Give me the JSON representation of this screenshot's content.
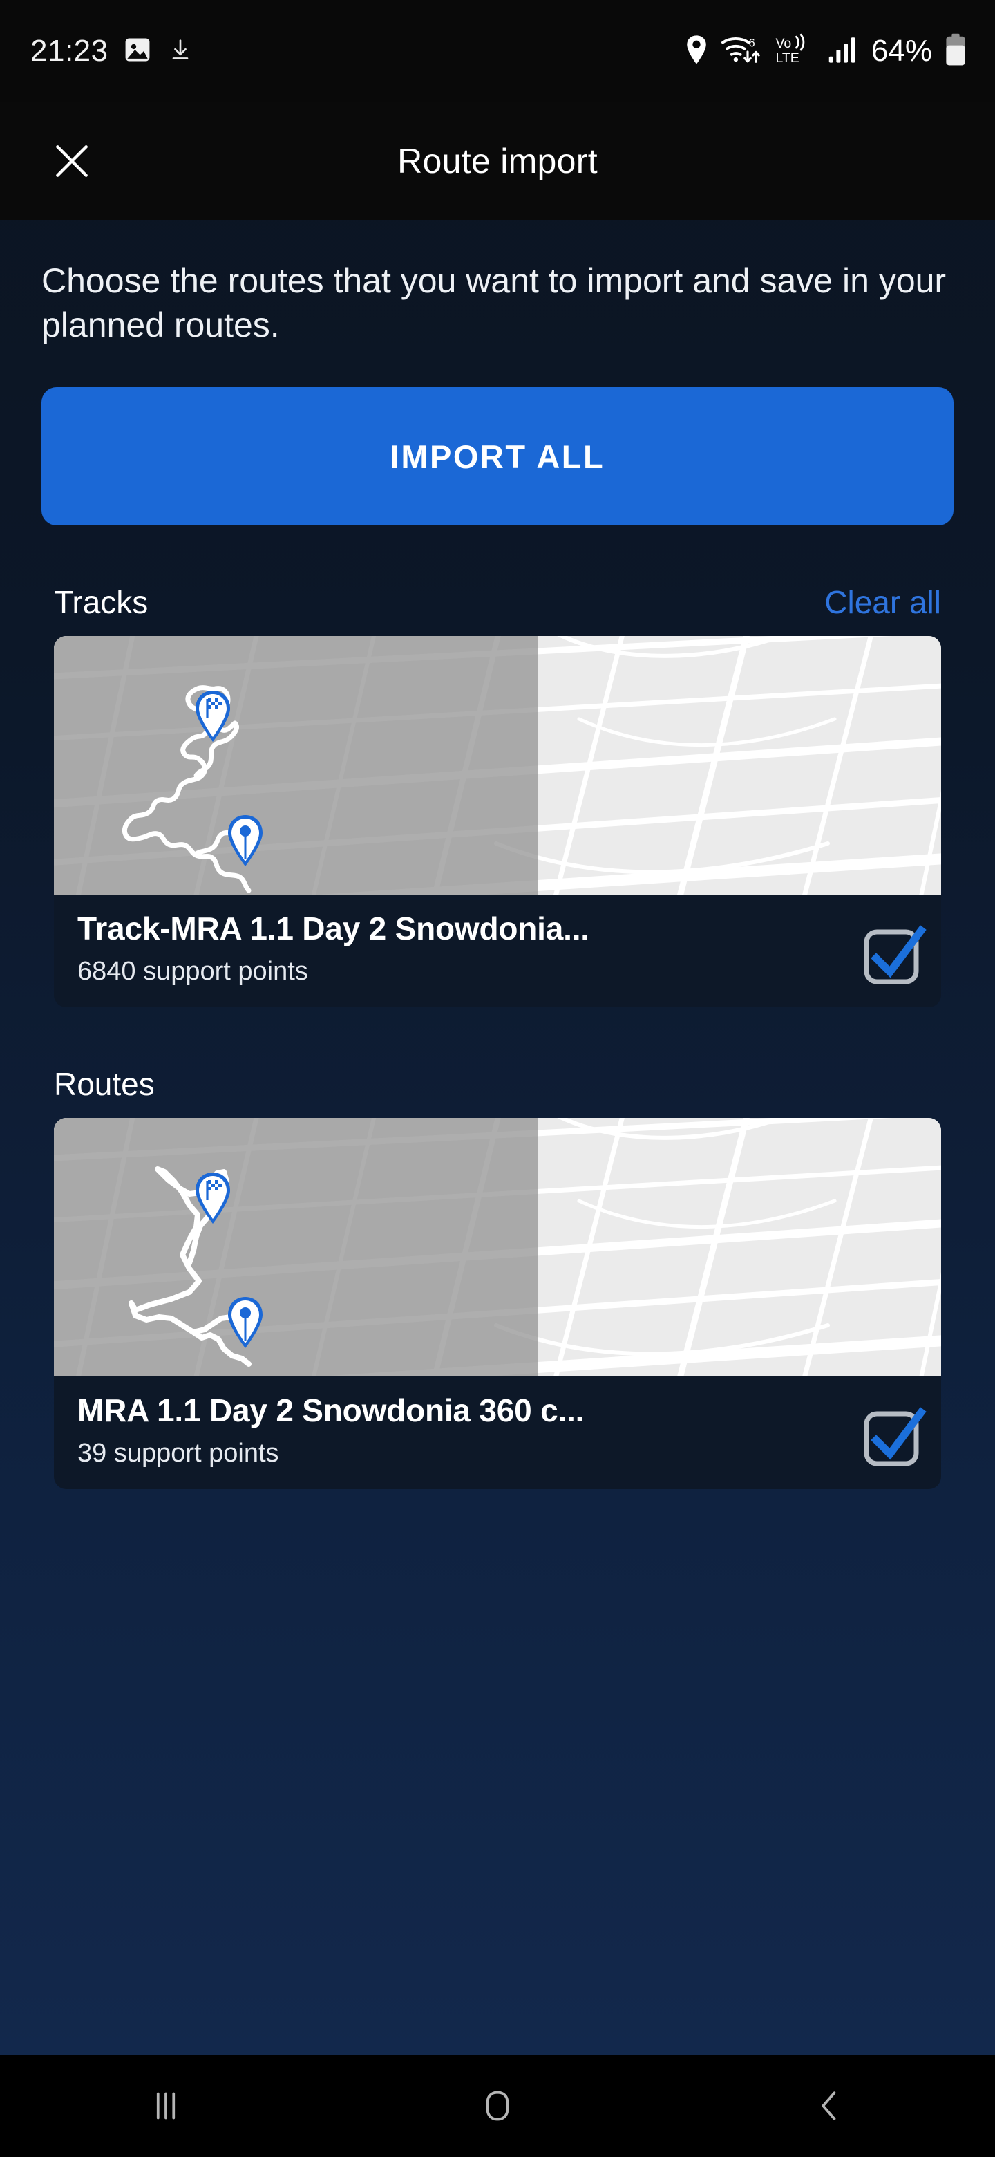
{
  "status_bar": {
    "time": "21:23",
    "battery_percent": "64%",
    "icons": [
      "image-icon",
      "download-icon",
      "location-pin-icon",
      "wifi-6-icon",
      "volte-icon",
      "cellular-signal-icon",
      "battery-icon"
    ]
  },
  "app_bar": {
    "close_label": "×",
    "title": "Route import"
  },
  "body": {
    "description": "Choose the routes that you want to import and save in your planned routes.",
    "import_all_label": "IMPORT ALL"
  },
  "sections": [
    {
      "title": "Tracks",
      "action_label": "Clear all",
      "items": [
        {
          "title": "Track-MRA 1.1 Day 2 Snowdonia...",
          "subtitle": "6840 support points",
          "checked": true
        }
      ]
    },
    {
      "title": "Routes",
      "action_label": "",
      "items": [
        {
          "title": "MRA 1.1 Day 2 Snowdonia 360 c...",
          "subtitle": "39 support points",
          "checked": true
        }
      ]
    }
  ],
  "nav_bar": {
    "recents_label": "recent-apps-icon",
    "home_label": "home-icon",
    "back_label": "back-icon"
  },
  "colors": {
    "accent_blue": "#1b68d6",
    "link_blue": "#2f74de",
    "page_bg_top": "#0b1421",
    "page_bg_bottom": "#13294e",
    "card_bg": "#0d1828",
    "bar_bg": "#0a0a0a",
    "text_primary": "#ffffff"
  }
}
